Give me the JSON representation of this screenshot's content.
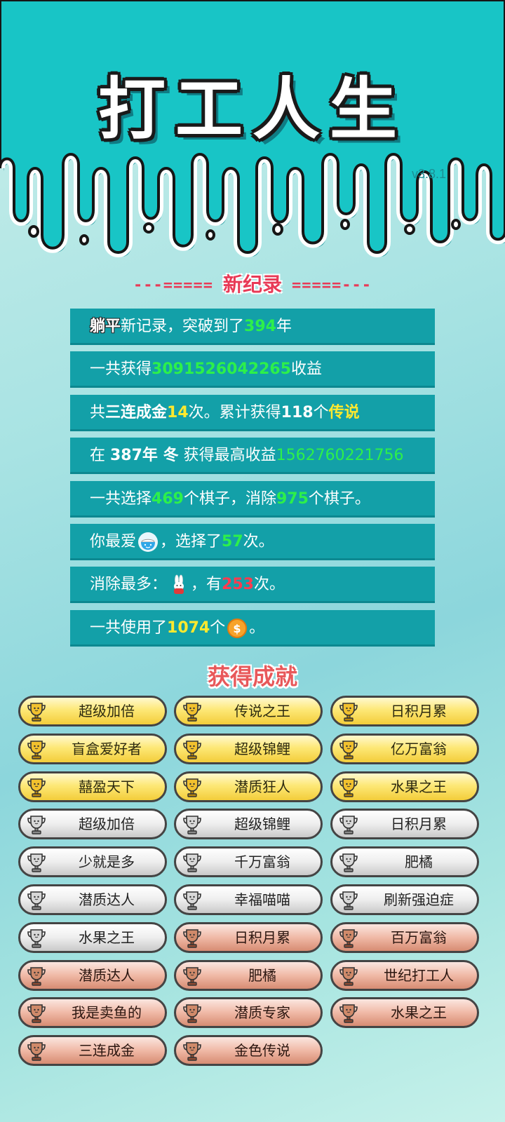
{
  "app": {
    "title": "打工人生",
    "version": "v3.8.1"
  },
  "record_section": {
    "dashes_left": "---=====",
    "title": "新纪录",
    "dashes_right": "=====---"
  },
  "stats": {
    "row1": {
      "hl": "躺平",
      "a": "新记录，突破到了",
      "num": "394",
      "b": "年"
    },
    "row2": {
      "a": "一共获得",
      "num": "3091526042265",
      "b": "收益"
    },
    "row3": {
      "a": "共",
      "w": "三连成金",
      "num": "14",
      "b": "次。累计获得",
      "num2": "118",
      "c": "个",
      "y": "传说"
    },
    "row4": {
      "a": "在 ",
      "w1": "387年 冬",
      "b": " 获得最高收益",
      "num": "1562760221756"
    },
    "row5": {
      "a": "一共选择",
      "num": "469",
      "b": "个棋子，消除",
      "num2": "975",
      "c": "个棋子。"
    },
    "row6": {
      "a": "你最爱",
      "icon": "rice-bowl-icon",
      "b": "，选择了",
      "num": "57",
      "c": "次。"
    },
    "row7": {
      "a": "消除最多：",
      "icon": "rabbit-icon",
      "b": "，有",
      "num": "253",
      "c": "次。"
    },
    "row8": {
      "a": "一共使用了",
      "num": "1074",
      "b": "个",
      "icon": "coin-icon",
      "c": "。"
    }
  },
  "achievements": {
    "title": "获得成就",
    "items": [
      {
        "label": "超级加倍",
        "tier": "gold"
      },
      {
        "label": "传说之王",
        "tier": "gold"
      },
      {
        "label": "日积月累",
        "tier": "gold"
      },
      {
        "label": "盲盒爱好者",
        "tier": "gold"
      },
      {
        "label": "超级锦鲤",
        "tier": "gold"
      },
      {
        "label": "亿万富翁",
        "tier": "gold"
      },
      {
        "label": "囍盈天下",
        "tier": "gold"
      },
      {
        "label": "潜质狂人",
        "tier": "gold"
      },
      {
        "label": "水果之王",
        "tier": "gold"
      },
      {
        "label": "超级加倍",
        "tier": "silver"
      },
      {
        "label": "超级锦鲤",
        "tier": "silver"
      },
      {
        "label": "日积月累",
        "tier": "silver"
      },
      {
        "label": "少就是多",
        "tier": "silver"
      },
      {
        "label": "千万富翁",
        "tier": "silver"
      },
      {
        "label": "肥橘",
        "tier": "silver"
      },
      {
        "label": "潜质达人",
        "tier": "silver"
      },
      {
        "label": "幸福喵喵",
        "tier": "silver"
      },
      {
        "label": "刷新强迫症",
        "tier": "silver"
      },
      {
        "label": "水果之王",
        "tier": "silver"
      },
      {
        "label": "日积月累",
        "tier": "bronze"
      },
      {
        "label": "百万富翁",
        "tier": "bronze"
      },
      {
        "label": "潜质达人",
        "tier": "bronze"
      },
      {
        "label": "肥橘",
        "tier": "bronze"
      },
      {
        "label": "世纪打工人",
        "tier": "bronze"
      },
      {
        "label": "我是卖鱼的",
        "tier": "bronze"
      },
      {
        "label": "潜质专家",
        "tier": "bronze"
      },
      {
        "label": "水果之王",
        "tier": "bronze"
      },
      {
        "label": "三连成金",
        "tier": "bronze"
      },
      {
        "label": "金色传说",
        "tier": "bronze"
      }
    ]
  },
  "colors": {
    "teal": "#17c4c7",
    "row_bg": "#13a0a8",
    "number_green": "#2df04a",
    "legend_yellow": "#ffe92e",
    "accent_red": "#e83a56"
  }
}
